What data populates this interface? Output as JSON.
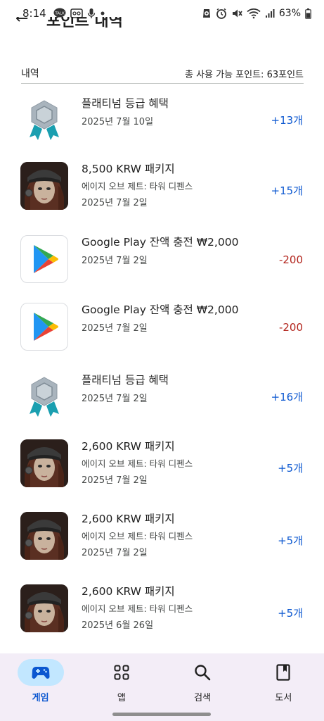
{
  "status_bar": {
    "time": "8:14",
    "battery": "63%",
    "left_icons": [
      "talk-icon",
      "oto-icon",
      "mic-icon",
      "dot-icon"
    ],
    "right_icons": [
      "alarm-icon",
      "clock-icon",
      "mute-icon",
      "wifi-icon",
      "signal-icon",
      "battery-icon"
    ]
  },
  "header": {
    "title_partial": "포인트 내역"
  },
  "section": {
    "title": "내역",
    "total": "총 사용 가능 포인트: 63포인트"
  },
  "items": [
    {
      "kind": "badge",
      "title": "플래티넘 등급 혜택",
      "subtitle": "",
      "date": "2025년 7월 10일",
      "amount": "+13개",
      "sign": "plus"
    },
    {
      "kind": "game",
      "title": "8,500 KRW 패키지",
      "subtitle": "에이지 오브 제트: 타워 디펜스",
      "date": "2025년 7월 2일",
      "amount": "+15개",
      "sign": "plus"
    },
    {
      "kind": "play",
      "title": "Google Play 잔액 충전 ₩2,000",
      "subtitle": "",
      "date": "2025년 7월 2일",
      "amount": "-200",
      "sign": "minus"
    },
    {
      "kind": "play",
      "title": "Google Play 잔액 충전 ₩2,000",
      "subtitle": "",
      "date": "2025년 7월 2일",
      "amount": "-200",
      "sign": "minus"
    },
    {
      "kind": "badge",
      "title": "플래티넘 등급 혜택",
      "subtitle": "",
      "date": "2025년 7월 2일",
      "amount": "+16개",
      "sign": "plus"
    },
    {
      "kind": "game",
      "title": "2,600 KRW 패키지",
      "subtitle": "에이지 오브 제트: 타워 디펜스",
      "date": "2025년 7월 2일",
      "amount": "+5개",
      "sign": "plus"
    },
    {
      "kind": "game",
      "title": "2,600 KRW 패키지",
      "subtitle": "에이지 오브 제트: 타워 디펜스",
      "date": "2025년 7월 2일",
      "amount": "+5개",
      "sign": "plus"
    },
    {
      "kind": "game",
      "title": "2,600 KRW 패키지",
      "subtitle": "에이지 오브 제트: 타워 디펜스",
      "date": "2025년 6월 26일",
      "amount": "+5개",
      "sign": "plus"
    }
  ],
  "nav": {
    "items": [
      {
        "label": "게임",
        "icon": "gamepad-icon",
        "active": true
      },
      {
        "label": "앱",
        "icon": "apps-grid-icon",
        "active": false
      },
      {
        "label": "검색",
        "icon": "search-icon",
        "active": false
      },
      {
        "label": "도서",
        "icon": "book-icon",
        "active": false
      }
    ]
  },
  "colors": {
    "positive": "#0b57d0",
    "negative": "#b3261e",
    "nav_background": "#f3edf7",
    "nav_active_pill": "#c2e7ff"
  }
}
